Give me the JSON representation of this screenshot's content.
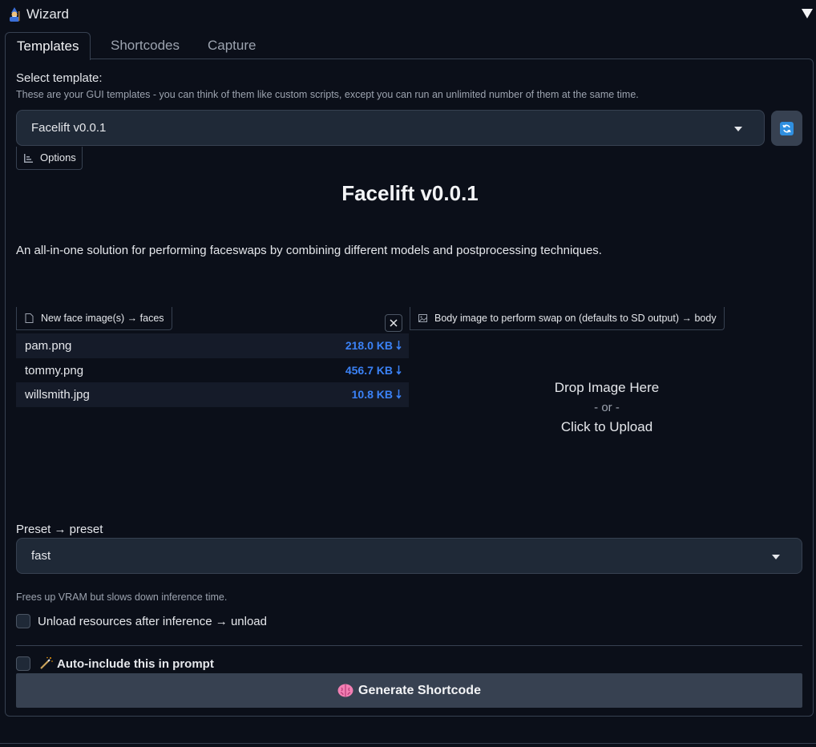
{
  "header": {
    "title": "Wizard"
  },
  "tabs": [
    {
      "label": "Templates",
      "active": true
    },
    {
      "label": "Shortcodes",
      "active": false
    },
    {
      "label": "Capture",
      "active": false
    }
  ],
  "template_select": {
    "label": "Select template:",
    "info": "These are your GUI templates - you can think of them like custom scripts, except you can run an unlimited number of them at the same time.",
    "value": "Facelift v0.0.1"
  },
  "options_label": "Options",
  "template": {
    "title": "Facelift v0.0.1",
    "description": "An all-in-one solution for performing faceswaps by combining different models and postprocessing techniques."
  },
  "faces_block": {
    "label": "New face image(s) → faces",
    "files": [
      {
        "name": "pam.png",
        "size": "218.0 KB"
      },
      {
        "name": "tommy.png",
        "size": "456.7 KB"
      },
      {
        "name": "willsmith.jpg",
        "size": "10.8 KB"
      }
    ]
  },
  "body_block": {
    "label": "Body image to perform swap on (defaults to SD output) → body",
    "drop_text": "Drop Image Here",
    "or_text": "- or -",
    "upload_text": "Click to Upload"
  },
  "preset": {
    "label": "Preset → preset",
    "value": "fast"
  },
  "unload": {
    "info": "Frees up VRAM but slows down inference time.",
    "label": "Unload resources after inference → unload",
    "checked": false
  },
  "auto_include": {
    "label": "Auto-include this in prompt",
    "checked": false
  },
  "generate_button": {
    "label": "Generate Shortcode"
  },
  "colors": {
    "background": "#0b0f19",
    "accent": "#3b82f6",
    "button": "#374151"
  }
}
